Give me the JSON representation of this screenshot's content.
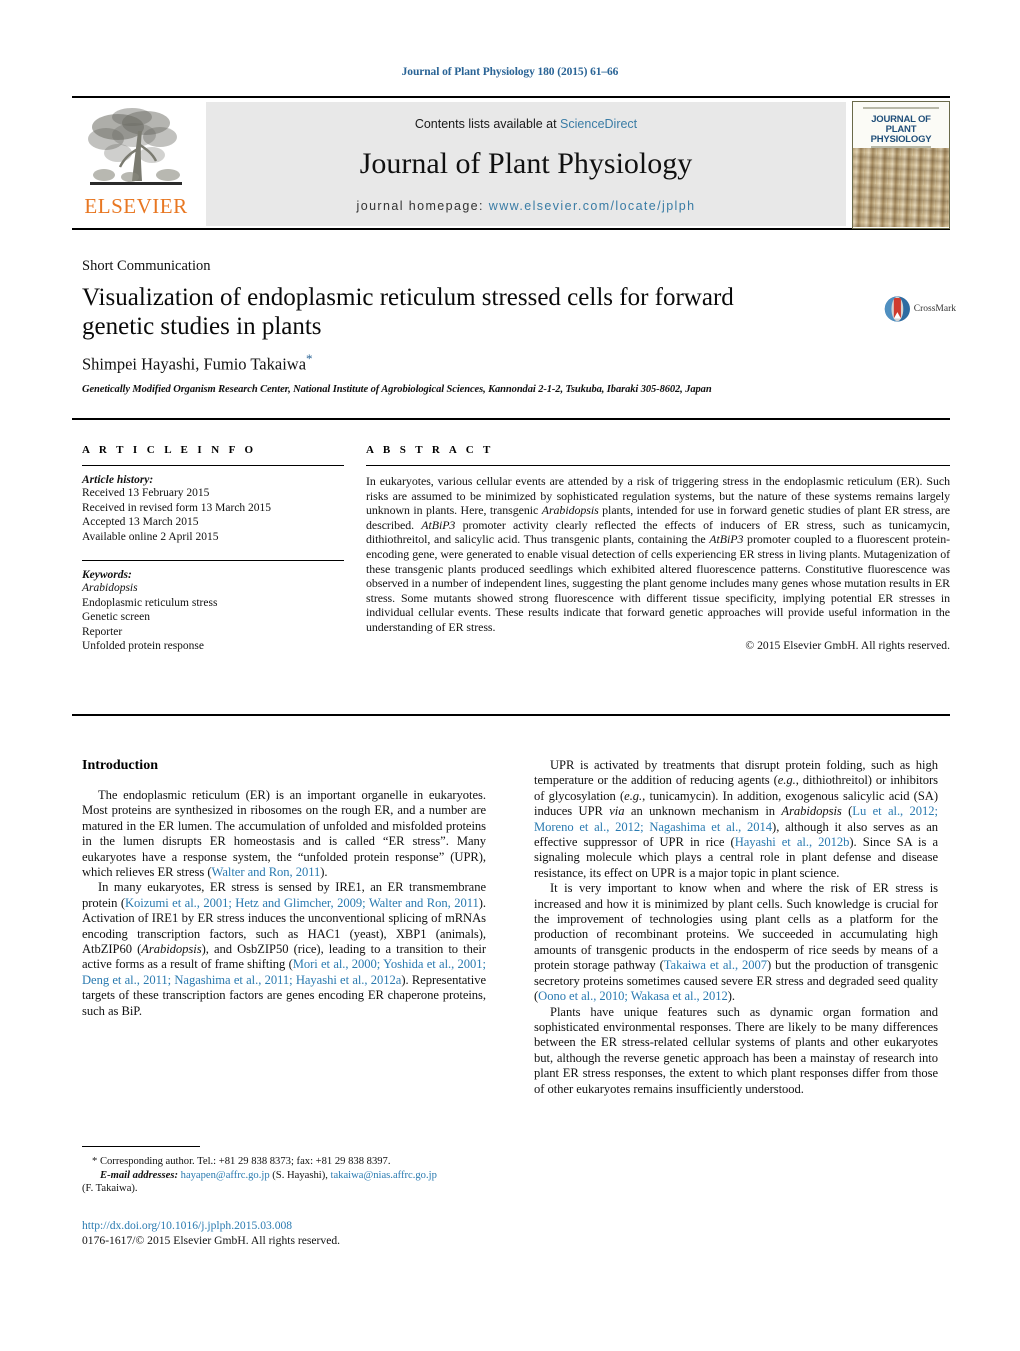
{
  "running_head": "Journal of Plant Physiology 180 (2015) 61–66",
  "masthead": {
    "contents_prefix": "Contents lists available at ",
    "sciencedirect": "ScienceDirect",
    "journal_title": "Journal of Plant Physiology",
    "homepage_prefix": "journal homepage: ",
    "homepage_url": "www.elsevier.com/locate/jplph",
    "publisher_wordmark": "ELSEVIER",
    "cover_title_line1": "JOURNAL OF",
    "cover_title_line2": "PLANT PHYSIOLOGY",
    "accent_link_color": "#3a7ca5",
    "publisher_color": "#E87722"
  },
  "article": {
    "type": "Short Communication",
    "title": "Visualization of endoplasmic reticulum stressed cells for forward genetic studies in plants",
    "authors": "Shimpei Hayashi, Fumio Takaiwa",
    "affiliation": "Genetically Modified Organism Research Center, National Institute of Agrobiological Sciences, Kannondai 2-1-2, Tsukuba, Ibaraki 305-8602, Japan",
    "crossmark_label": "CrossMark"
  },
  "article_info": {
    "heading": "A R T I C L E   I N F O",
    "history_label": "Article history:",
    "history": [
      "Received 13 February 2015",
      "Received in revised form 13 March 2015",
      "Accepted 13 March 2015",
      "Available online 2 April 2015"
    ],
    "keywords_label": "Keywords:",
    "keywords": [
      "Arabidopsis",
      "Endoplasmic reticulum stress",
      "Genetic screen",
      "Reporter",
      "Unfolded protein response"
    ]
  },
  "abstract": {
    "heading": "A B S T R A C T",
    "text_part1": "In eukaryotes, various cellular events are attended by a risk of triggering stress in the endoplasmic reticulum (ER). Such risks are assumed to be minimized by sophisticated regulation systems, but the nature of these systems remains largely unknown in plants. Here, transgenic ",
    "italic1": "Arabidopsis",
    "text_part2": " plants, intended for use in forward genetic studies of plant ER stress, are described. ",
    "italic2": "AtBiP3",
    "text_part3": " promoter activity clearly reflected the effects of inducers of ER stress, such as tunicamycin, dithiothreitol, and salicylic acid. Thus transgenic plants, containing the ",
    "italic3": "AtBiP3",
    "text_part4": " promoter coupled to a fluorescent protein-encoding gene, were generated to enable visual detection of cells experiencing ER stress in living plants. Mutagenization of these transgenic plants produced seedlings which exhibited altered fluorescence patterns. Constitutive fluorescence was observed in a number of independent lines, suggesting the plant genome includes many genes whose mutation results in ER stress. Some mutants showed strong fluorescence with different tissue specificity, implying potential ER stresses in individual cellular events. These results indicate that forward genetic approaches will provide useful information in the understanding of ER stress.",
    "copyright": "© 2015 Elsevier GmbH. All rights reserved."
  },
  "introduction": {
    "heading": "Introduction",
    "left_p1_a": "The endoplasmic reticulum (ER) is an important organelle in eukaryotes. Most proteins are synthesized in ribosomes on the rough ER, and a number are matured in the ER lumen. The accumulation of unfolded and misfolded proteins in the lumen disrupts ER homeostasis and is called “ER stress”. Many eukaryotes have a response system, the “unfolded protein response” (UPR), which relieves ER stress (",
    "left_p1_ref1": "Walter and Ron, 2011",
    "left_p1_b": ").",
    "left_p2_a": "In many eukaryotes, ER stress is sensed by IRE1, an ER transmembrane protein (",
    "left_p2_ref1": "Koizumi et al., 2001; Hetz and Glimcher, 2009; Walter and Ron, 2011",
    "left_p2_b": "). Activation of IRE1 by ER stress induces the unconventional splicing of mRNAs encoding transcription factors, such as HAC1 (yeast), XBP1 (animals), AtbZIP60 (",
    "left_p2_ital1": "Arabidopsis",
    "left_p2_c": "), and OsbZIP50 (rice), leading to a transition to their active forms as a result of frame shifting (",
    "left_p2_ref2": "Mori et al., 2000; Yoshida et al., 2001; Deng et al., 2011; Nagashima et al., 2011; Hayashi et al., 2012a",
    "left_p2_d": "). Representative targets of these transcription factors are genes encoding ER chaperone proteins, such as BiP.",
    "right_p1_a": "UPR is activated by treatments that disrupt protein folding, such as high temperature or the addition of reducing agents (",
    "right_p1_ital1": "e.g.",
    "right_p1_b": ", dithiothreitol) or inhibitors of glycosylation (",
    "right_p1_ital2": "e.g.",
    "right_p1_c": ", tunicamycin). In addition, exogenous salicylic acid (SA) induces UPR ",
    "right_p1_ital3": "via",
    "right_p1_d": " an unknown mechanism in ",
    "right_p1_ital4": "Arabidopsis",
    "right_p1_e": " (",
    "right_p1_ref1": "Lu et al., 2012; Moreno et al., 2012; Nagashima et al., 2014",
    "right_p1_f": "), although it also serves as an effective suppressor of UPR in rice (",
    "right_p1_ref2": "Hayashi et al., 2012b",
    "right_p1_g": "). Since SA is a signaling molecule which plays a central role in plant defense and disease resistance, its effect on UPR is a major topic in plant science.",
    "right_p2_a": "It is very important to know when and where the risk of ER stress is increased and how it is minimized by plant cells. Such knowledge is crucial for the improvement of technologies using plant cells as a platform for the production of recombinant proteins. We succeeded in accumulating high amounts of transgenic products in the endosperm of rice seeds by means of a protein storage pathway (",
    "right_p2_ref1": "Takaiwa et al., 2007",
    "right_p2_b": ") but the production of transgenic secretory proteins sometimes caused severe ER stress and degraded seed quality (",
    "right_p2_ref2": "Oono et al., 2010; Wakasa et al., 2012",
    "right_p2_c": ").",
    "right_p3": "Plants have unique features such as dynamic organ formation and sophisticated environmental responses. There are likely to be many differences between the ER stress-related cellular systems of plants and other eukaryotes but, although the reverse genetic approach has been a mainstay of research into plant ER stress responses, the extent to which plant responses differ from those of other eukaryotes remains insufficiently understood."
  },
  "footnotes": {
    "corresponding": "* Corresponding author. Tel.: +81 29 838 8373; fax: +81 29 838 8397.",
    "email_label": "E-mail addresses:",
    "email1": "hayapen@affrc.go.jp",
    "email1_owner": " (S. Hayashi), ",
    "email2": "takaiwa@nias.affrc.go.jp",
    "email2_owner": "(F. Takaiwa)."
  },
  "doi": {
    "url": "http://dx.doi.org/10.1016/j.jplph.2015.03.008",
    "issn_line": "0176-1617/© 2015 Elsevier GmbH. All rights reserved."
  }
}
